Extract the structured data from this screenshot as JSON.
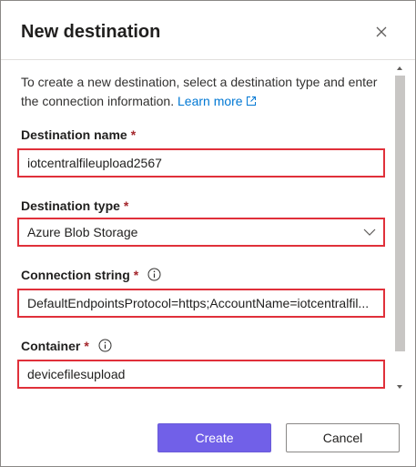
{
  "dialog": {
    "title": "New destination",
    "close_icon": "close-icon",
    "intro_text": "To create a new destination, select a destination type and enter the connection information.",
    "learn_more": "Learn more",
    "learn_more_icon": "external-link-icon"
  },
  "fields": {
    "destination_name": {
      "label": "Destination name",
      "required": "*",
      "value": "iotcentralfileupload2567"
    },
    "destination_type": {
      "label": "Destination type",
      "required": "*",
      "value": "Azure Blob Storage"
    },
    "connection_string": {
      "label": "Connection string",
      "required": "*",
      "value": "DefaultEndpointsProtocol=https;AccountName=iotcentralfil...",
      "info_icon": "info-icon"
    },
    "container": {
      "label": "Container",
      "required": "*",
      "value": "devicefilesupload",
      "info_icon": "info-icon"
    }
  },
  "buttons": {
    "create": "Create",
    "cancel": "Cancel"
  },
  "colors": {
    "primary": "#7160e8",
    "highlight_border": "#e0303a",
    "link": "#0078d4",
    "required": "#a4262c"
  }
}
